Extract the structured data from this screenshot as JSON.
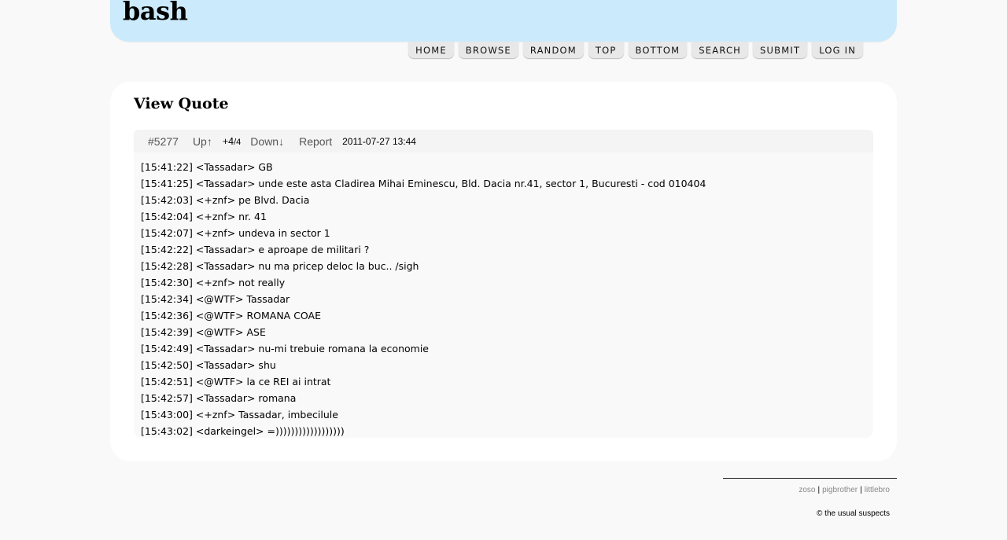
{
  "header": {
    "logo": "bash",
    "nav": [
      "HOME",
      "BROWSE",
      "RANDOM",
      "TOP",
      "BOTTOM",
      "SEARCH",
      "SUBMIT",
      "LOG IN"
    ]
  },
  "page_title": "View Quote",
  "quote": {
    "id": "#5277",
    "up_label": "Up↑",
    "score": "+4",
    "score_sep": "/",
    "votes": "4",
    "down_label": "Down↓",
    "report_label": "Report",
    "date": "2011-07-27 13:44",
    "lines": [
      "[15:41:22] <Tassadar> GB",
      "[15:41:25] <Tassadar> unde este asta Cladirea Mihai Eminescu, Bld. Dacia nr.41, sector 1, Bucuresti - cod 010404",
      "[15:42:03] <+znf> pe Blvd. Dacia",
      "[15:42:04] <+znf> nr. 41",
      "[15:42:07] <+znf> undeva in sector 1",
      "[15:42:22] <Tassadar> e aproape de militari ?",
      "[15:42:28] <Tassadar> nu ma pricep deloc la buc.. /sigh",
      "[15:42:30] <+znf> not really",
      "[15:42:34] <@WTF> Tassadar",
      "[15:42:36] <@WTF> ROMANA COAE",
      "[15:42:39] <@WTF> ASE",
      "[15:42:49] <Tassadar> nu-mi trebuie romana la economie",
      "[15:42:50] <Tassadar> shu",
      "[15:42:51] <@WTF> la ce REI ai intrat",
      "[15:42:57] <Tassadar> romana",
      "[15:43:00] <+znf> Tassadar, imbecilule",
      "[15:43:02] <darkeingel> =))))))))))))))))))"
    ]
  },
  "footer": {
    "links": [
      "zoso",
      "pigbrother",
      "littlebro"
    ],
    "separator": "|",
    "copyright": "© the usual suspects"
  }
}
